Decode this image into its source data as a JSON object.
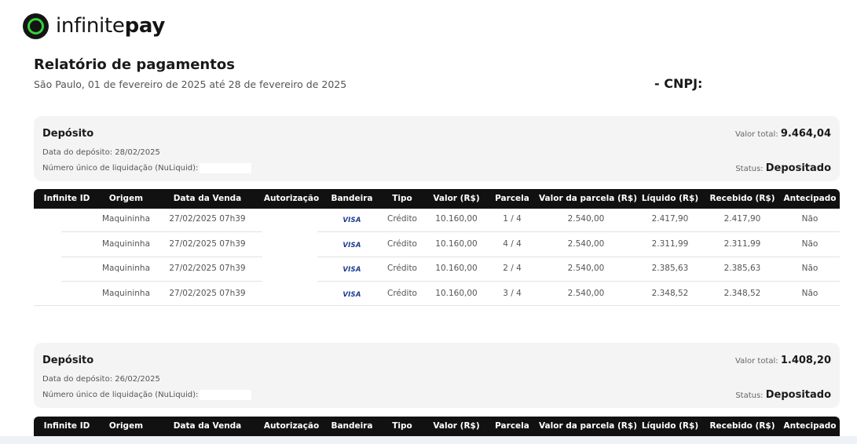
{
  "brand": {
    "logo_light": "infinite",
    "logo_bold": "pay"
  },
  "report": {
    "title": "Relatório de pagamentos",
    "period": "São Paulo, 01 de fevereiro de 2025 até 28 de fevereiro de 2025",
    "cnpj_label": "- CNPJ:"
  },
  "columns": [
    "Infinite ID",
    "Origem",
    "Data da Venda",
    "Autorização",
    "Bandeira",
    "Tipo",
    "Valor (R$)",
    "Parcela",
    "Valor da parcela (R$)",
    "Líquido (R$)",
    "Recebido (R$)",
    "Antecipado"
  ],
  "deposits": [
    {
      "title": "Depósito",
      "date": "Data do depósito: 28/02/2025",
      "nuliquid_label": "Número único de liquidação (NuLiquid):",
      "total_label": "Valor total:",
      "total_value": "9.464,04",
      "status_label": "Status:",
      "status_value": "Depositado",
      "rows": [
        {
          "origem": "Maquininha",
          "data": "27/02/2025 07h39",
          "bandeira": "VISA",
          "tipo": "Crédito",
          "valor": "10.160,00",
          "parcela": "1 / 4",
          "valor_parcela": "2.540,00",
          "liquido": "2.417,90",
          "recebido": "2.417,90",
          "antecipado": "Não"
        },
        {
          "origem": "Maquininha",
          "data": "27/02/2025 07h39",
          "bandeira": "VISA",
          "tipo": "Crédito",
          "valor": "10.160,00",
          "parcela": "4 / 4",
          "valor_parcela": "2.540,00",
          "liquido": "2.311,99",
          "recebido": "2.311,99",
          "antecipado": "Não"
        },
        {
          "origem": "Maquininha",
          "data": "27/02/2025 07h39",
          "bandeira": "VISA",
          "tipo": "Crédito",
          "valor": "10.160,00",
          "parcela": "2 / 4",
          "valor_parcela": "2.540,00",
          "liquido": "2.385,63",
          "recebido": "2.385,63",
          "antecipado": "Não"
        },
        {
          "origem": "Maquininha",
          "data": "27/02/2025 07h39",
          "bandeira": "VISA",
          "tipo": "Crédito",
          "valor": "10.160,00",
          "parcela": "3 / 4",
          "valor_parcela": "2.540,00",
          "liquido": "2.348,52",
          "recebido": "2.348,52",
          "antecipado": "Não"
        }
      ]
    },
    {
      "title": "Depósito",
      "date": "Data do depósito: 26/02/2025",
      "nuliquid_label": "Número único de liquidação (NuLiquid):",
      "total_label": "Valor total:",
      "total_value": "1.408,20",
      "status_label": "Status:",
      "status_value": "Depositado",
      "rows": []
    }
  ],
  "colors": {
    "accent_green": "#35d13a",
    "header_bg": "#111111",
    "card_bg": "#f4f4f4",
    "visa_blue": "#1a3a8f"
  }
}
